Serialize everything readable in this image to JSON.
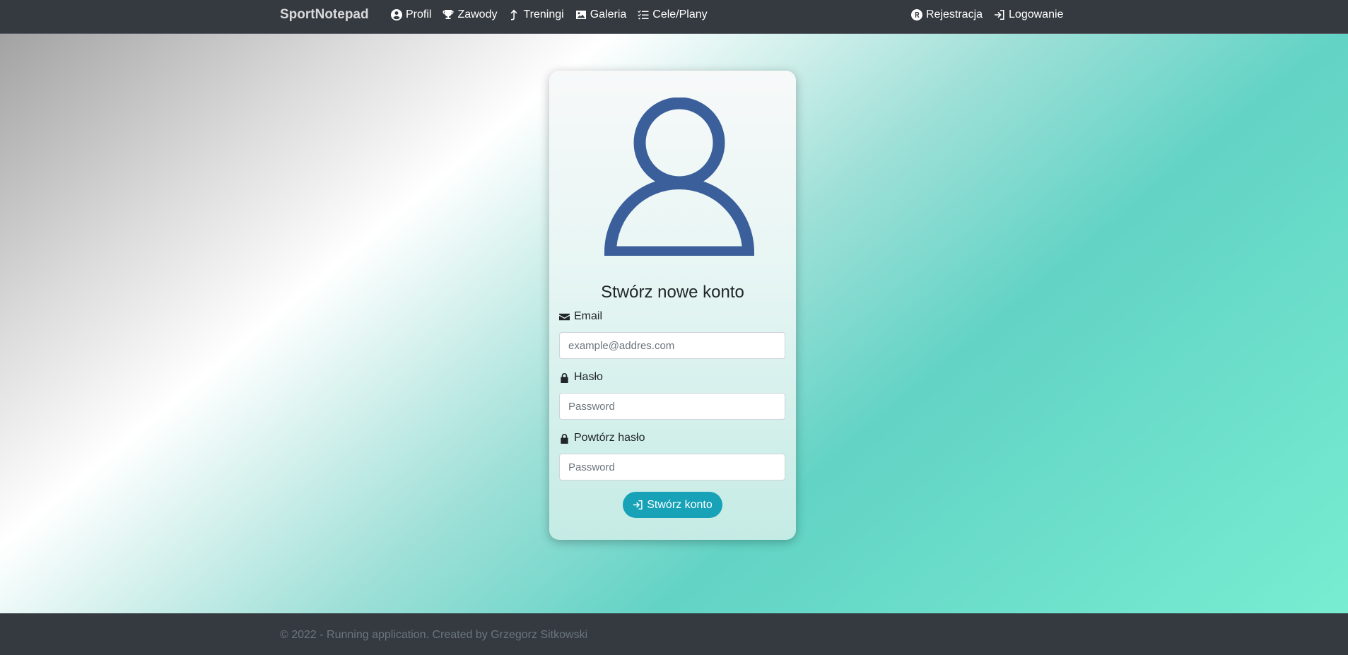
{
  "navbar": {
    "brand": "SportNotepad",
    "left_items": [
      {
        "label": "Profil",
        "icon": "user-circle-icon"
      },
      {
        "label": "Zawody",
        "icon": "trophy-icon"
      },
      {
        "label": "Treningi",
        "icon": "arrow-up-icon"
      },
      {
        "label": "Galeria",
        "icon": "image-icon"
      },
      {
        "label": "Cele/Plany",
        "icon": "list-check-icon"
      }
    ],
    "right_items": [
      {
        "label": "Rejestracja",
        "icon": "registered-icon"
      },
      {
        "label": "Logowanie",
        "icon": "sign-in-icon"
      }
    ]
  },
  "form": {
    "avatar_icon": "user-avatar-icon",
    "title": "Stwórz nowe konto",
    "email": {
      "label": "Email",
      "icon": "envelope-icon",
      "placeholder": "example@addres.com",
      "value": ""
    },
    "password": {
      "label": "Hasło",
      "icon": "lock-icon",
      "placeholder": "Password",
      "value": ""
    },
    "password_repeat": {
      "label": "Powtórz hasło",
      "icon": "lock-icon",
      "placeholder": "Password",
      "value": ""
    },
    "submit": {
      "label": "Stwórz konto",
      "icon": "sign-in-icon"
    }
  },
  "footer": {
    "text": "© 2022 - Running application. Created by Grzegorz Sitkowski"
  },
  "colors": {
    "navbar_bg": "#343a40",
    "avatar": "#3a5f9a",
    "button": "#17a2b8",
    "footer_text": "#6c757d"
  }
}
